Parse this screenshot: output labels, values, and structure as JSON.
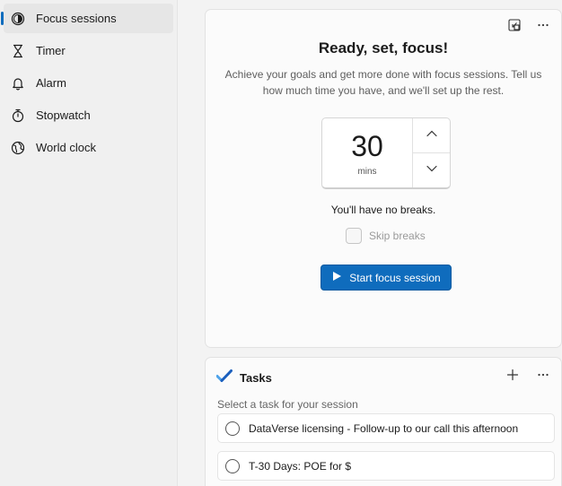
{
  "sidebar": {
    "items": [
      {
        "label": "Focus sessions",
        "icon": "focus-icon",
        "active": true
      },
      {
        "label": "Timer",
        "icon": "hourglass-icon"
      },
      {
        "label": "Alarm",
        "icon": "bell-icon"
      },
      {
        "label": "Stopwatch",
        "icon": "stopwatch-icon"
      },
      {
        "label": "World clock",
        "icon": "globe-icon"
      }
    ]
  },
  "focus": {
    "title": "Ready, set, focus!",
    "subtitle": "Achieve your goals and get more done with focus sessions. Tell us how much time you have, and we'll set up the rest.",
    "duration_value": "30",
    "duration_unit": "mins",
    "breaks_text": "You'll have no breaks.",
    "skip_breaks_label": "Skip breaks",
    "skip_breaks_checked": false,
    "start_label": "Start focus session"
  },
  "tasks": {
    "title": "Tasks",
    "hint": "Select a task for your session",
    "items": [
      {
        "label": "DataVerse licensing - Follow-up to our call this afternoon"
      },
      {
        "label": "T-30 Days: POE for $"
      }
    ]
  },
  "colors": {
    "accent": "#0f6cbd",
    "tasks_logo_dark": "#1b5fbd",
    "tasks_logo_light": "#4fa3ea"
  }
}
